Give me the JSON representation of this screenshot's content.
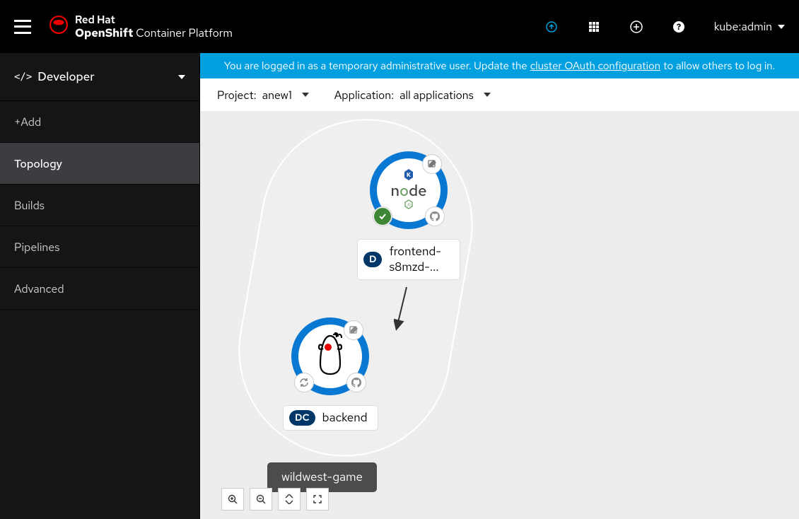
{
  "header": {
    "brand_top": "Red Hat",
    "brand_bold": "OpenShift",
    "brand_rest": " Container Platform",
    "user": "kube:admin"
  },
  "sidebar": {
    "perspective": "Developer",
    "items": [
      "+Add",
      "Topology",
      "Builds",
      "Pipelines",
      "Advanced"
    ],
    "active": "Topology"
  },
  "banner": {
    "pre": "You are logged in as a temporary administrative user. Update the ",
    "link": "cluster OAuth configuration",
    "post": " to allow others to log in."
  },
  "toolbar": {
    "project_label": "Project:",
    "project_value": "anew1",
    "app_label": "Application:",
    "app_value": "all applications"
  },
  "topology": {
    "app_group": "wildwest-game",
    "nodes": [
      {
        "kind": "D",
        "label": "frontend-s8mzd-...",
        "runtime": "node"
      },
      {
        "kind": "DC",
        "label": "backend",
        "runtime": "java"
      }
    ]
  }
}
